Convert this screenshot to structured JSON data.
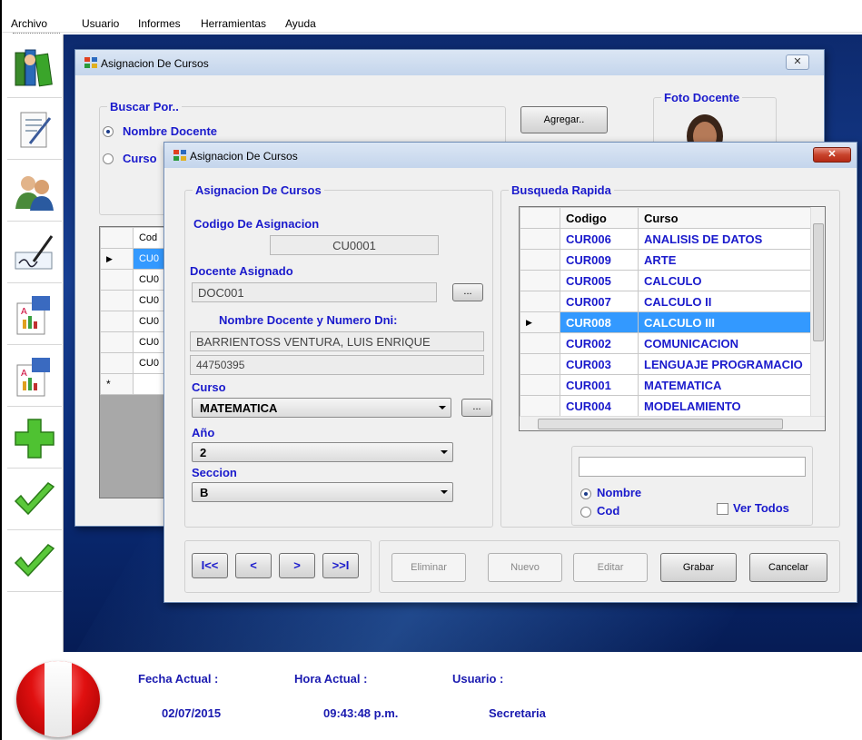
{
  "menu": [
    "Archivo",
    "Usuario",
    "Informes",
    "Herramientas",
    "Ayuda"
  ],
  "sidebar": [
    "books-icon",
    "document-edit-icon",
    "users-icon",
    "signature-icon",
    "report-icon",
    "report-icon",
    "add-icon",
    "check-icon",
    "check-icon"
  ],
  "back_window": {
    "title": "Asignacion De Cursos",
    "close": "✕",
    "search_group": "Buscar Por..",
    "radio_nombre": "Nombre Docente",
    "radio_curso": "Curso",
    "add_button": "Agregar..",
    "photo_group": "Foto Docente",
    "grid_header": "Cod",
    "grid_rows": [
      "CU0",
      "CU0",
      "CU0",
      "CU0",
      "CU0",
      "CU0"
    ],
    "new_row_marker": "*"
  },
  "front_window": {
    "title": "Asignacion De Cursos",
    "close": "✕",
    "assign_group": "Asignacion De Cursos",
    "codigo_label": "Codigo De Asignacion",
    "codigo_value": "CU0001",
    "docente_label": "Docente Asignado",
    "docente_value": "DOC001",
    "ellipsis": "...",
    "nombre_label": "Nombre Docente  y Numero Dni:",
    "nombre_value": "BARRIENTOSS VENTURA, LUIS ENRIQUE",
    "dni_value": "44750395",
    "curso_label": "Curso",
    "curso_value": "MATEMATICA",
    "anio_label": "Año",
    "anio_value": "2",
    "seccion_label": "Seccion",
    "seccion_value": "B",
    "search_group": "Busqueda Rapida",
    "col_codigo": "Codigo",
    "col_curso": "Curso",
    "courses": [
      {
        "code": "CUR006",
        "name": "ANALISIS DE DATOS"
      },
      {
        "code": "CUR009",
        "name": "ARTE"
      },
      {
        "code": "CUR005",
        "name": "CALCULO"
      },
      {
        "code": "CUR007",
        "name": "CALCULO II"
      },
      {
        "code": "CUR008",
        "name": "CALCULO III"
      },
      {
        "code": "CUR002",
        "name": "COMUNICACION"
      },
      {
        "code": "CUR003",
        "name": "LENGUAJE PROGRAMACIO"
      },
      {
        "code": "CUR001",
        "name": "MATEMATICA"
      },
      {
        "code": "CUR004",
        "name": "MODELAMIENTO"
      }
    ],
    "selected_index": 4,
    "search_placeholder": "",
    "radio_nombre": "Nombre",
    "radio_cod": "Cod",
    "ver_todos": "Ver Todos",
    "nav": {
      "first": "I<<",
      "prev": "<",
      "next": ">",
      "last": ">>I"
    },
    "actions": {
      "eliminar": "Eliminar",
      "nuevo": "Nuevo",
      "editar": "Editar",
      "grabar": "Grabar",
      "cancelar": "Cancelar"
    }
  },
  "status": {
    "fecha_label": "Fecha Actual :",
    "hora_label": "Hora Actual :",
    "usuario_label": "Usuario :",
    "fecha_value": "02/07/2015",
    "hora_value": "09:43:48 p.m.",
    "usuario_value": "Secretaria"
  }
}
